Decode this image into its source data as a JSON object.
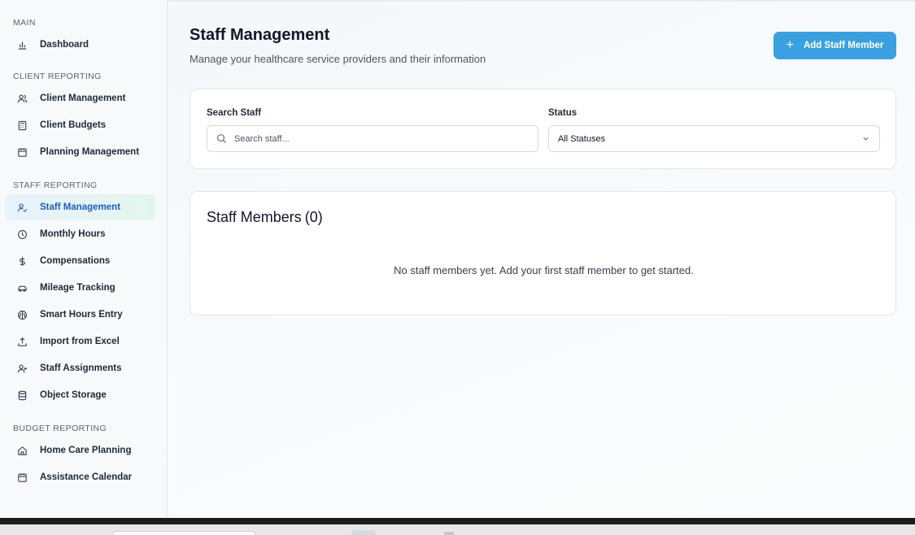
{
  "sidebar": {
    "sections": [
      {
        "title": "MAIN",
        "items": [
          {
            "label": "Dashboard",
            "icon": "bar-chart-icon"
          }
        ]
      },
      {
        "title": "CLIENT REPORTING",
        "items": [
          {
            "label": "Client Management",
            "icon": "users-icon"
          },
          {
            "label": "Client Budgets",
            "icon": "calculator-icon"
          },
          {
            "label": "Planning Management",
            "icon": "calendar-icon"
          }
        ]
      },
      {
        "title": "STAFF REPORTING",
        "items": [
          {
            "label": "Staff Management",
            "icon": "user-check-icon",
            "active": true
          },
          {
            "label": "Monthly Hours",
            "icon": "clock-icon"
          },
          {
            "label": "Compensations",
            "icon": "dollar-icon"
          },
          {
            "label": "Mileage Tracking",
            "icon": "car-icon"
          },
          {
            "label": "Smart Hours Entry",
            "icon": "brain-icon"
          },
          {
            "label": "Import from Excel",
            "icon": "upload-icon"
          },
          {
            "label": "Staff Assignments",
            "icon": "user-plus-icon"
          },
          {
            "label": "Object Storage",
            "icon": "database-icon"
          }
        ]
      },
      {
        "title": "BUDGET REPORTING",
        "items": [
          {
            "label": "Home Care Planning",
            "icon": "home-icon"
          },
          {
            "label": "Assistance Calendar",
            "icon": "calendar-icon"
          }
        ]
      }
    ]
  },
  "header": {
    "title": "Staff Management",
    "subtitle": "Manage your healthcare service providers and their information",
    "add_button_label": "Add Staff Member"
  },
  "filters": {
    "search_label": "Search Staff",
    "search_placeholder": "Search staff...",
    "search_value": "",
    "status_label": "Status",
    "status_value": "All Statuses"
  },
  "members": {
    "title": "Staff Members",
    "count_text": "(0)",
    "empty_message": "No staff members yet. Add your first staff member to get started."
  },
  "colors": {
    "accent": "#3ba0df",
    "active_nav_text": "#1f5fb8"
  }
}
